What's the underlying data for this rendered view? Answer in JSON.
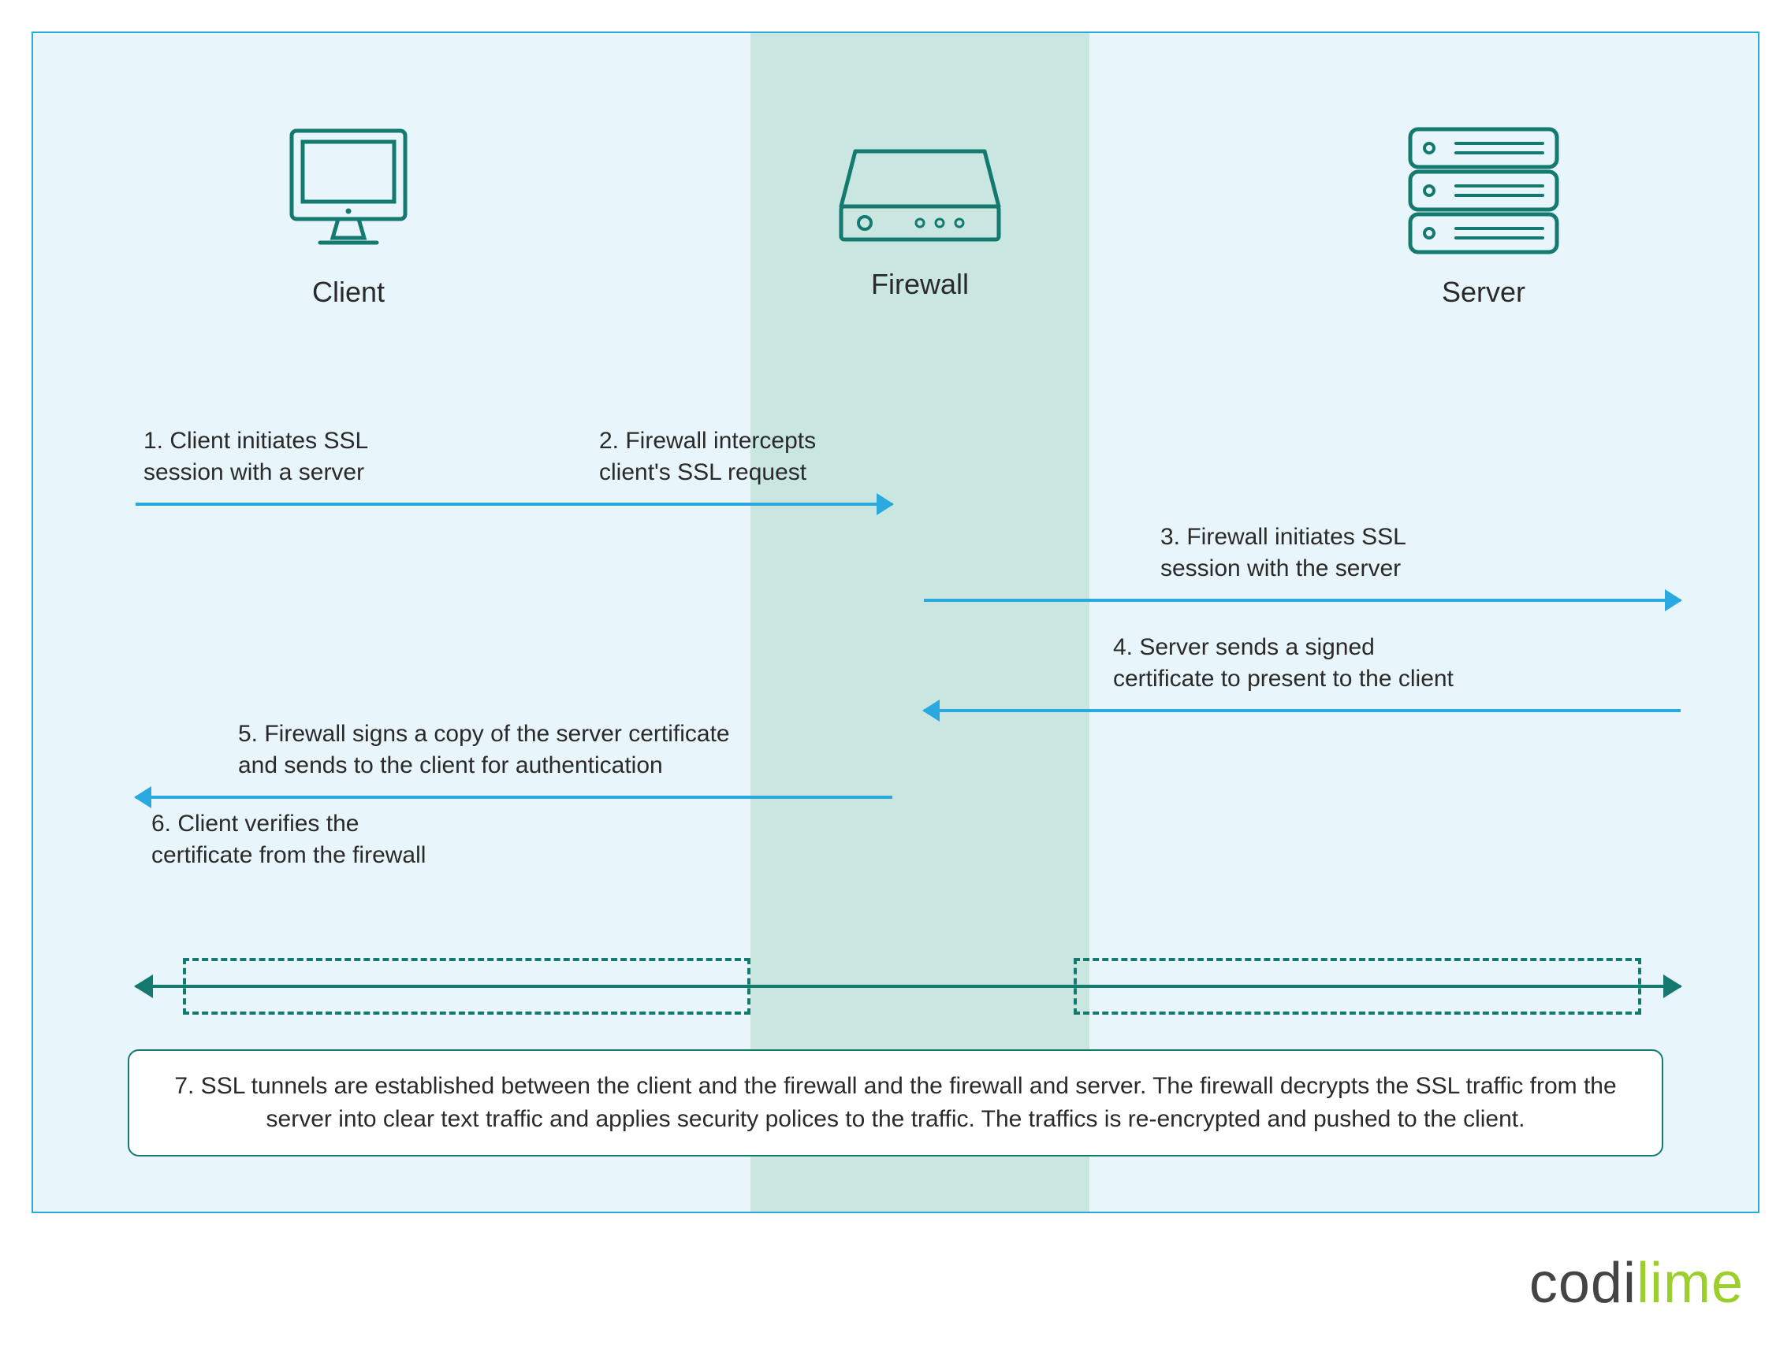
{
  "nodes": {
    "client": "Client",
    "firewall": "Firewall",
    "server": "Server"
  },
  "steps": {
    "s1": "1. Client initiates SSL\nsession with a server",
    "s2": "2. Firewall intercepts\nclient's SSL request",
    "s3": "3. Firewall initiates SSL\nsession with the server",
    "s4": "4. Server sends a signed\ncertificate to present to the client",
    "s5": "5. Firewall signs a copy of the server certificate\nand sends to the client for  authentication",
    "s6": "6. Client verifies the\ncertificate from the firewall",
    "s7": "7. SSL tunnels are established between the client and the firewall and the firewall and server. The firewall decrypts the SSL traffic from the server into clear text traffic and applies security polices to the traffic. The traffics is re-encrypted and pushed to the client."
  },
  "brand": {
    "part1": "codi",
    "part2": "lime"
  }
}
